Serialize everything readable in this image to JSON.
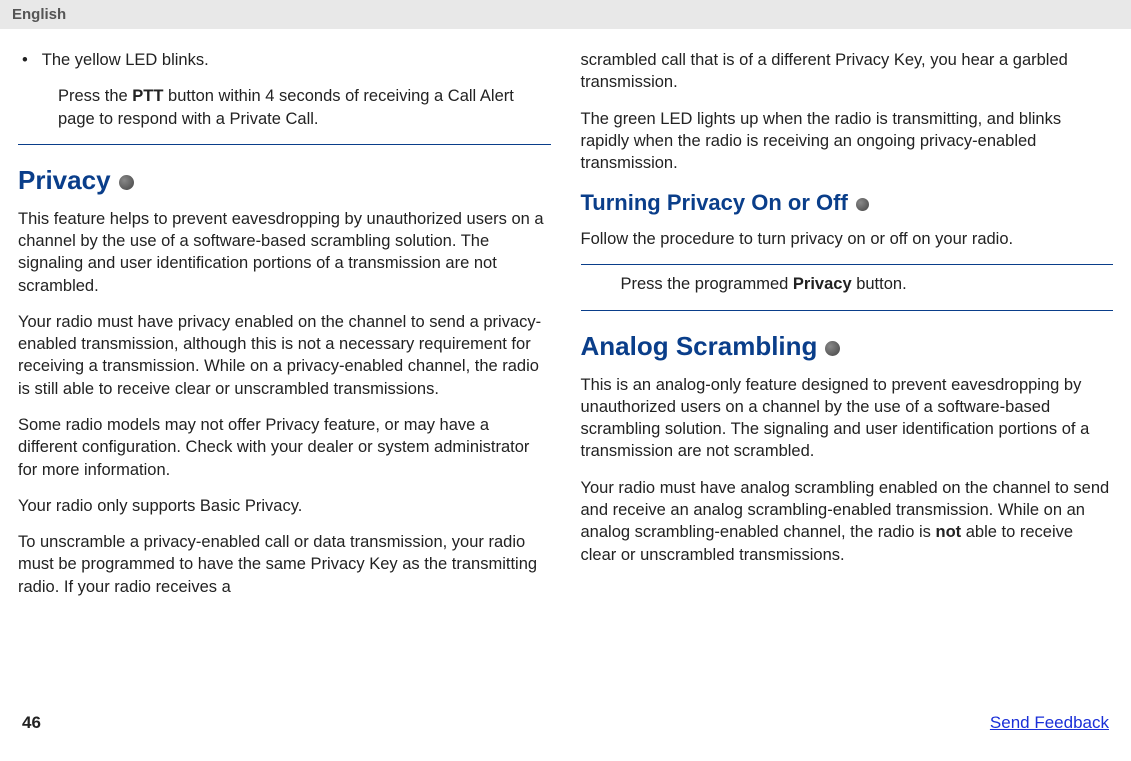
{
  "header": {
    "language": "English"
  },
  "col1": {
    "bullet1": "The yellow LED blinks.",
    "ptt_before": "Press the ",
    "ptt_bold": "PTT",
    "ptt_after": " button within 4 seconds of receiving a Call Alert page to respond with a Private Call.",
    "privacy_heading": "Privacy",
    "privacy_p1": "This feature helps to prevent eavesdropping by unauthorized users on a channel by the use of a software-based scrambling solution. The signaling and user identification portions of a transmission are not scrambled.",
    "privacy_p2": "Your radio must have privacy enabled on the channel to send a privacy-enabled transmission, although this is not a necessary requirement for receiving a transmission. While on a privacy-enabled channel, the radio is still able to receive clear or unscrambled transmissions.",
    "privacy_p3": "Some radio models may not offer Privacy feature, or may have a different configuration. Check with your dealer or system administrator for more information.",
    "privacy_p4": "Your radio only supports Basic Privacy.",
    "privacy_p5": "To unscramble a privacy-enabled call or data transmission, your radio must be programmed to have the same Privacy Key as the transmitting radio. If your radio receives a"
  },
  "col2": {
    "cont_p1": "scrambled call that is of a different Privacy Key, you hear a garbled transmission.",
    "cont_p2": "The green LED lights up when the radio is transmitting, and blinks rapidly when the radio is receiving an ongoing privacy-enabled transmission.",
    "turning_heading": "Turning Privacy On or Off",
    "turning_p1": "Follow the procedure to turn privacy on or off on your radio.",
    "turning_step_before": "Press the programmed ",
    "turning_step_bold": "Privacy",
    "turning_step_after": " button.",
    "analog_heading": "Analog Scrambling",
    "analog_p1": "This is an analog-only feature designed to prevent eavesdropping by unauthorized users on a channel by the use of a software-based scrambling solution. The signaling and user identification portions of a transmission are not scrambled.",
    "analog_p2_before": "Your radio must have analog scrambling enabled on the channel to send and receive an analog scrambling-enabled transmission. While on an analog scrambling-enabled channel, the radio is ",
    "analog_p2_bold": "not",
    "analog_p2_after": " able to receive clear or unscrambled transmissions."
  },
  "footer": {
    "page": "46",
    "feedback": "Send Feedback"
  }
}
